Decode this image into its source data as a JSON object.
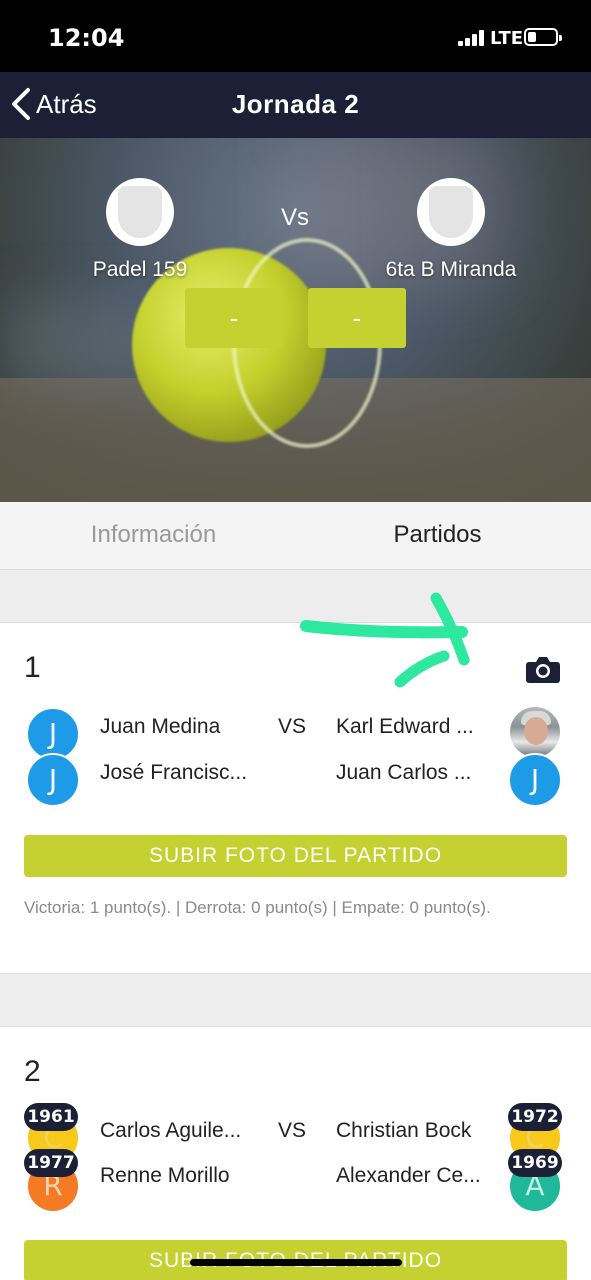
{
  "status_bar": {
    "time": "12:04",
    "network": "LTE"
  },
  "nav": {
    "back_label": "Atrás",
    "title": "Jornada 2"
  },
  "hero": {
    "team_left": "Padel 159",
    "vs": "Vs",
    "team_right": "6ta B Miranda",
    "score_left": "-",
    "score_right": "-"
  },
  "tabs": [
    {
      "label": "Información",
      "active": false
    },
    {
      "label": "Partidos",
      "active": true
    }
  ],
  "matches": [
    {
      "number": "1",
      "vs": "VS",
      "left_players": [
        {
          "name": "Juan Medina",
          "initial": "J"
        },
        {
          "name": "José Francisc...",
          "initial": "J"
        }
      ],
      "right_players": [
        {
          "name": "Karl Edward ...",
          "initial": ""
        },
        {
          "name": "Juan Carlos ...",
          "initial": "J"
        }
      ],
      "upload_label": "SUBIR FOTO DEL PARTIDO",
      "points_text": "Victoria: 1 punto(s). | Derrota: 0 punto(s) | Empate: 0 punto(s)."
    },
    {
      "number": "2",
      "vs": "VS",
      "left_players": [
        {
          "name": "Carlos Aguile...",
          "initial": "C",
          "year": "1961"
        },
        {
          "name": "Renne Morillo",
          "initial": "R",
          "year": "1977"
        }
      ],
      "right_players": [
        {
          "name": "Christian Bock",
          "initial": "C",
          "year": "1972"
        },
        {
          "name": "Alexander Ce...",
          "initial": "A",
          "year": "1969"
        }
      ],
      "upload_label": "SUBIR FOTO DEL PARTIDO"
    }
  ],
  "colors": {
    "accent": "#c4d130",
    "navy": "#1c2036",
    "avatar_blue": "#1d9be7",
    "annotation": "#2ee8a0"
  }
}
